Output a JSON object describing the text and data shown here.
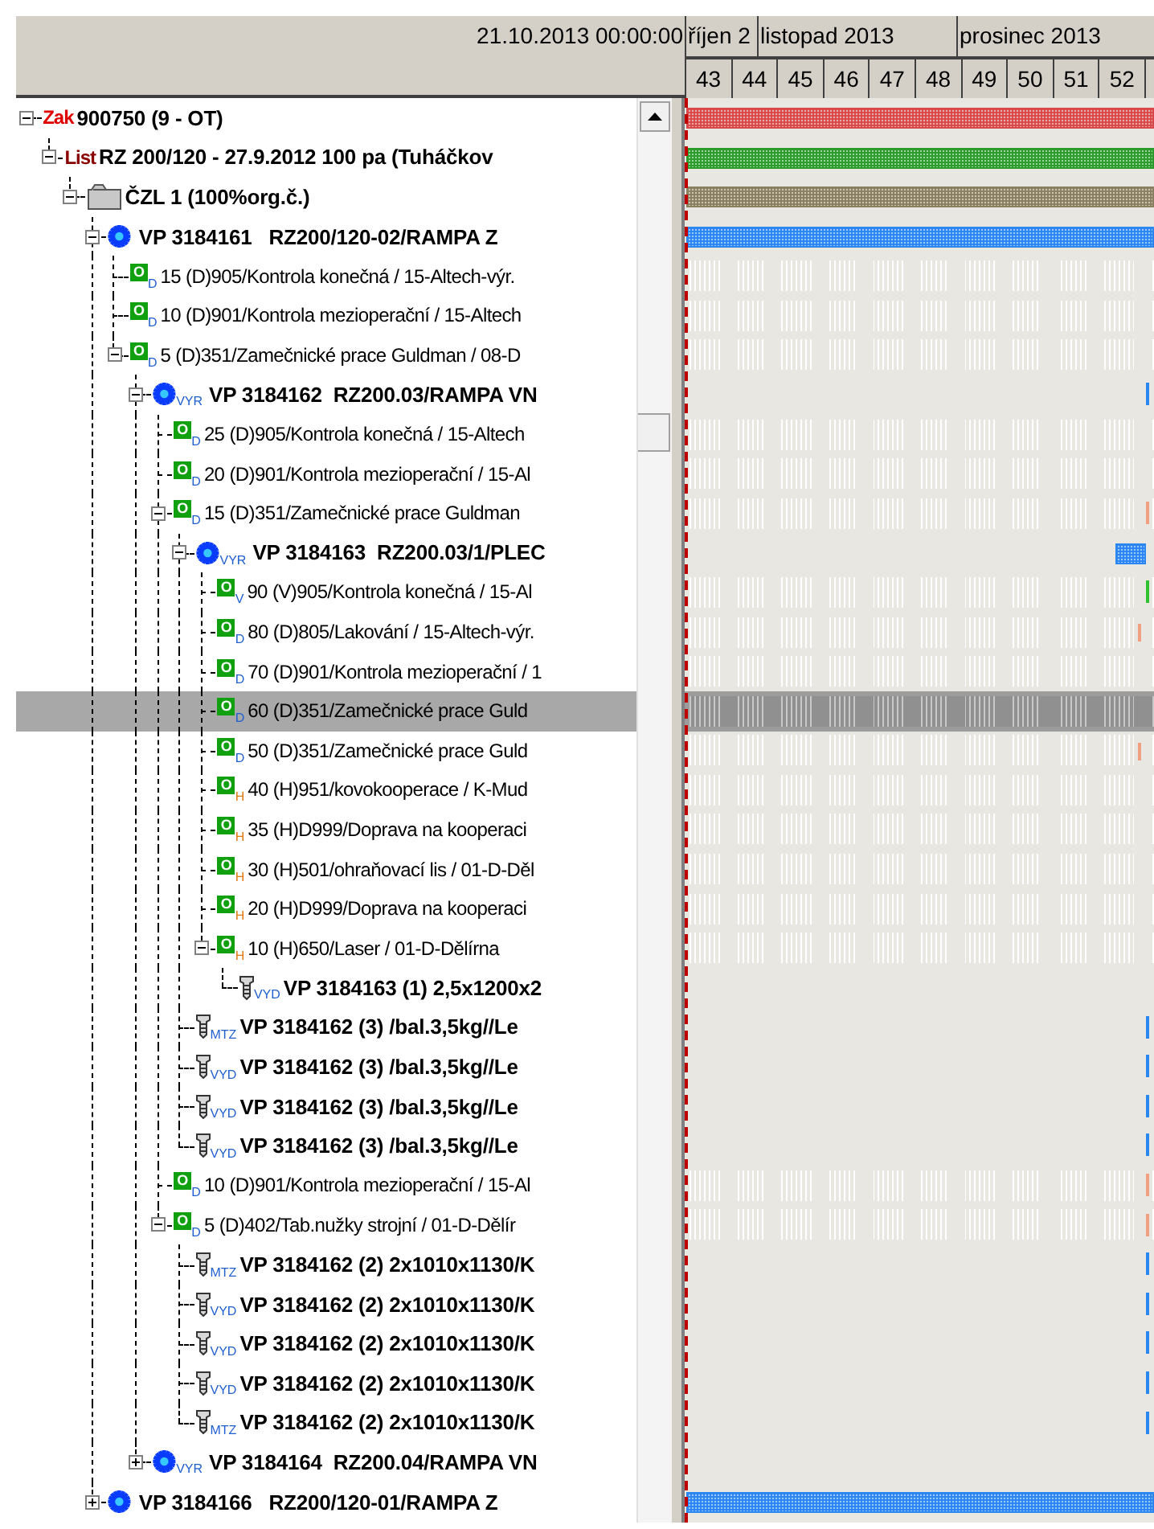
{
  "header": {
    "date": "21.10.2013 00:00:00",
    "months": [
      "říjen 2",
      "listopad 2013",
      "prosinec 2013"
    ],
    "weeks": [
      "43",
      "44",
      "45",
      "46",
      "47",
      "48",
      "49",
      "50",
      "51",
      "52"
    ]
  },
  "tree": [
    {
      "kind": "order",
      "tag": "Zak",
      "text": "900750 (9 - OT)",
      "expanded": true,
      "selected": false,
      "bar": {
        "kind": "full",
        "color": "#d84848"
      },
      "children": [
        {
          "kind": "list",
          "tag": "List",
          "text": "RZ 200/120 - 27.9.2012 100 pa (Tuháčkov",
          "expanded": true,
          "selected": false,
          "bar": {
            "kind": "full",
            "color": "#2a9a2a"
          },
          "children": [
            {
              "kind": "folder",
              "text": "ČZL 1 (100%org.č.)",
              "expanded": true,
              "selected": false,
              "bar": {
                "kind": "full",
                "color": "#8a8060"
              },
              "children": [
                {
                  "kind": "vp",
                  "text": "VP 3184161   RZ200/120-02/RAMPA Z",
                  "expanded": true,
                  "selected": false,
                  "bar": {
                    "kind": "full",
                    "color": "#2a86f0"
                  },
                  "children": [
                    {
                      "kind": "op",
                      "badge": "O",
                      "sub": "D",
                      "color": "#1f5fd0",
                      "text": "15 (D)905/Kontrola konečná / 15-Altech-výr.",
                      "selected": false
                    },
                    {
                      "kind": "op",
                      "badge": "O",
                      "sub": "D",
                      "color": "#1f5fd0",
                      "text": "10 (D)901/Kontrola mezioperační / 15-Altech",
                      "selected": false
                    },
                    {
                      "kind": "op",
                      "badge": "O",
                      "sub": "D",
                      "color": "#1f5fd0",
                      "text": "5 (D)351/Zamečnické prace Guldman / 08-D",
                      "expanded": true,
                      "selected": false,
                      "children": [
                        {
                          "kind": "vp",
                          "sub": "VYR",
                          "color": "#1f5fd0",
                          "text": "VP 3184162  RZ200.03/RAMPA VN",
                          "expanded": true,
                          "selected": false,
                          "bar": {
                            "kind": "tick",
                            "color": "#2a86f0"
                          },
                          "children": [
                            {
                              "kind": "op",
                              "badge": "O",
                              "sub": "D",
                              "color": "#1f5fd0",
                              "text": "25 (D)905/Kontrola konečná / 15-Altech",
                              "selected": false
                            },
                            {
                              "kind": "op",
                              "badge": "O",
                              "sub": "D",
                              "color": "#1f5fd0",
                              "text": "20 (D)901/Kontrola mezioperační / 15-Al",
                              "selected": false
                            },
                            {
                              "kind": "op",
                              "badge": "O",
                              "sub": "D",
                              "color": "#1f5fd0",
                              "text": "15 (D)351/Zamečnické prace Guldman",
                              "expanded": true,
                              "selected": false,
                              "bar": {
                                "kind": "tick",
                                "color": "#f0a080"
                              },
                              "children": [
                                {
                                  "kind": "vp",
                                  "sub": "VYR",
                                  "color": "#1f5fd0",
                                  "text": "VP 3184163  RZ200.03/1/PLEC",
                                  "expanded": true,
                                  "selected": false,
                                  "bar": {
                                    "kind": "block",
                                    "color": "#2a86f0"
                                  },
                                  "children": [
                                    {
                                      "kind": "op",
                                      "badge": "O",
                                      "sub": "V",
                                      "color": "#1f5fd0",
                                      "text": "90 (V)905/Kontrola konečná / 15-Al",
                                      "selected": false,
                                      "bar": {
                                        "kind": "tick",
                                        "color": "#30c030"
                                      }
                                    },
                                    {
                                      "kind": "op",
                                      "badge": "O",
                                      "sub": "D",
                                      "color": "#1f5fd0",
                                      "text": "80 (D)805/Lakování / 15-Altech-výr.",
                                      "selected": false,
                                      "bar": {
                                        "kind": "mark",
                                        "color": "#f0a080"
                                      }
                                    },
                                    {
                                      "kind": "op",
                                      "badge": "O",
                                      "sub": "D",
                                      "color": "#1f5fd0",
                                      "text": "70 (D)901/Kontrola mezioperační / 1",
                                      "selected": false
                                    },
                                    {
                                      "kind": "op",
                                      "badge": "O",
                                      "sub": "D",
                                      "color": "#1f5fd0",
                                      "text": "60 (D)351/Zamečnické prace Guld",
                                      "selected": true
                                    },
                                    {
                                      "kind": "op",
                                      "badge": "O",
                                      "sub": "D",
                                      "color": "#1f5fd0",
                                      "text": "50 (D)351/Zamečnické prace Guld",
                                      "selected": false,
                                      "bar": {
                                        "kind": "mark",
                                        "color": "#f0a080"
                                      }
                                    },
                                    {
                                      "kind": "op",
                                      "badge": "O",
                                      "sub": "H",
                                      "color": "#e07a10",
                                      "text": "40 (H)951/kovokooperace / K-Mud",
                                      "selected": false
                                    },
                                    {
                                      "kind": "op",
                                      "badge": "O",
                                      "sub": "H",
                                      "color": "#e07a10",
                                      "text": "35 (H)D999/Doprava na kooperaci",
                                      "selected": false
                                    },
                                    {
                                      "kind": "op",
                                      "badge": "O",
                                      "sub": "H",
                                      "color": "#e07a10",
                                      "text": "30 (H)501/ohraňovací lis / 01-D-Děl",
                                      "selected": false
                                    },
                                    {
                                      "kind": "op",
                                      "badge": "O",
                                      "sub": "H",
                                      "color": "#e07a10",
                                      "text": "20 (H)D999/Doprava na kooperaci",
                                      "selected": false
                                    },
                                    {
                                      "kind": "op",
                                      "badge": "O",
                                      "sub": "H",
                                      "color": "#e07a10",
                                      "text": "10 (H)650/Laser / 01-D-Dělírna",
                                      "expanded": true,
                                      "selected": false,
                                      "children": [
                                        {
                                          "kind": "material",
                                          "sub": "VYD",
                                          "color": "#1f5fd0",
                                          "text": "VP 3184163 (1) 2,5x1200x2",
                                          "selected": false
                                        }
                                      ]
                                    }
                                  ]
                                },
                                {
                                  "kind": "material",
                                  "sub": "MTZ",
                                  "color": "#1f5fd0",
                                  "text": "VP 3184162 (3) /bal.3,5kg//Le",
                                  "selected": false,
                                  "bar": {
                                    "kind": "tick",
                                    "color": "#2a86f0"
                                  }
                                },
                                {
                                  "kind": "material",
                                  "sub": "VYD",
                                  "color": "#1f5fd0",
                                  "text": "VP 3184162 (3) /bal.3,5kg//Le",
                                  "selected": false,
                                  "bar": {
                                    "kind": "tick",
                                    "color": "#2a86f0"
                                  }
                                },
                                {
                                  "kind": "material",
                                  "sub": "VYD",
                                  "color": "#1f5fd0",
                                  "text": "VP 3184162 (3) /bal.3,5kg//Le",
                                  "selected": false,
                                  "bar": {
                                    "kind": "tick",
                                    "color": "#2a86f0"
                                  }
                                },
                                {
                                  "kind": "material",
                                  "sub": "VYD",
                                  "color": "#1f5fd0",
                                  "text": "VP 3184162 (3) /bal.3,5kg//Le",
                                  "selected": false,
                                  "bar": {
                                    "kind": "tick",
                                    "color": "#2a86f0"
                                  }
                                }
                              ]
                            },
                            {
                              "kind": "op",
                              "badge": "O",
                              "sub": "D",
                              "color": "#1f5fd0",
                              "text": "10 (D)901/Kontrola mezioperační / 15-Al",
                              "selected": false,
                              "bar": {
                                "kind": "tick",
                                "color": "#f0a080"
                              }
                            },
                            {
                              "kind": "op",
                              "badge": "O",
                              "sub": "D",
                              "color": "#1f5fd0",
                              "text": "5 (D)402/Tab.nužky strojní / 01-D-Dělír",
                              "expanded": true,
                              "selected": false,
                              "bar": {
                                "kind": "tick",
                                "color": "#f0a080"
                              },
                              "children": [
                                {
                                  "kind": "material",
                                  "sub": "MTZ",
                                  "color": "#1f5fd0",
                                  "text": "VP 3184162 (2) 2x1010x1130/K",
                                  "selected": false,
                                  "bar": {
                                    "kind": "tick",
                                    "color": "#2a86f0"
                                  }
                                },
                                {
                                  "kind": "material",
                                  "sub": "VYD",
                                  "color": "#1f5fd0",
                                  "text": "VP 3184162 (2) 2x1010x1130/K",
                                  "selected": false,
                                  "bar": {
                                    "kind": "tick",
                                    "color": "#2a86f0"
                                  }
                                },
                                {
                                  "kind": "material",
                                  "sub": "VYD",
                                  "color": "#1f5fd0",
                                  "text": "VP 3184162 (2) 2x1010x1130/K",
                                  "selected": false,
                                  "bar": {
                                    "kind": "tick",
                                    "color": "#2a86f0"
                                  }
                                },
                                {
                                  "kind": "material",
                                  "sub": "VYD",
                                  "color": "#1f5fd0",
                                  "text": "VP 3184162 (2) 2x1010x1130/K",
                                  "selected": false,
                                  "bar": {
                                    "kind": "tick",
                                    "color": "#2a86f0"
                                  }
                                },
                                {
                                  "kind": "material",
                                  "sub": "MTZ",
                                  "color": "#1f5fd0",
                                  "text": "VP 3184162 (2) 2x1010x1130/K",
                                  "selected": false,
                                  "bar": {
                                    "kind": "tick",
                                    "color": "#2a86f0"
                                  }
                                }
                              ]
                            }
                          ]
                        },
                        {
                          "kind": "vp",
                          "sub": "VYR",
                          "color": "#1f5fd0",
                          "text": "VP 3184164  RZ200.04/RAMPA VN",
                          "expanded": false,
                          "selected": false
                        }
                      ]
                    }
                  ]
                },
                {
                  "kind": "vp",
                  "text": "VP 3184166   RZ200/120-01/RAMPA Z",
                  "expanded": false,
                  "selected": false,
                  "bar": {
                    "kind": "full",
                    "color": "#2a86f0"
                  }
                }
              ]
            }
          ]
        }
      ]
    }
  ]
}
